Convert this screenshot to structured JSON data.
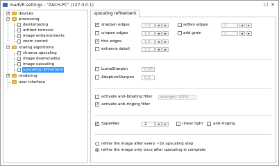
{
  "window": {
    "title": "madVR settings - \"ZACH-PC\" (127.0.0.1)",
    "close_glyph": "✕",
    "maximize_glyph": "☐"
  },
  "tree": {
    "items": [
      {
        "label": "devices",
        "icon": "folder-icon",
        "expander": "+"
      },
      {
        "label": "processing",
        "icon": "folder-icon",
        "expander": "−"
      },
      {
        "label": "deinterlacing",
        "icon": "page-icon"
      },
      {
        "label": "artifact removal",
        "icon": "page-icon"
      },
      {
        "label": "image enhancements",
        "icon": "page-icon"
      },
      {
        "label": "zoom control",
        "icon": "page-icon"
      },
      {
        "label": "scaling algorithms",
        "icon": "folder-icon",
        "expander": "−"
      },
      {
        "label": "chroma upscaling",
        "icon": "page-icon"
      },
      {
        "label": "image downscaling",
        "icon": "page-icon"
      },
      {
        "label": "image upscaling",
        "icon": "page-icon"
      },
      {
        "label": "upscaling refinement",
        "icon": "page-icon",
        "selected": true
      },
      {
        "label": "rendering",
        "icon": "folder-icon",
        "expander": "+"
      },
      {
        "label": "user interface",
        "icon": "folder-icon"
      }
    ]
  },
  "tab": {
    "label": "upscaling refinement"
  },
  "panel": {
    "sharpen_edges": {
      "label": "sharpen edges",
      "checked": true,
      "value": "1.0"
    },
    "crispen_edges": {
      "label": "crispen edges",
      "checked": false,
      "value": "1.0"
    },
    "thin_edges": {
      "label": "thin edges",
      "checked": true,
      "value": "1.0"
    },
    "enhance_detail": {
      "label": "enhance detail",
      "checked": false,
      "value": "1.0"
    },
    "soften_edges": {
      "label": "soften edges",
      "checked": false,
      "value": "2"
    },
    "add_grain": {
      "label": "add grain",
      "checked": false,
      "value": "2"
    },
    "luma_sharpen": {
      "label": "LumaSharpen",
      "checked": false,
      "value": "0.65"
    },
    "adaptive_sharpen": {
      "label": "AdaptiveSharpen",
      "checked": false,
      "value": "0.5"
    },
    "anti_bloating": {
      "label": "activate anti-bloating filter",
      "checked": false,
      "strength": "strength: 100%"
    },
    "anti_ringing": {
      "label": "activate anti-ringing filter",
      "checked": true
    },
    "superres": {
      "label": "SuperRes",
      "checked": true,
      "value": "2"
    },
    "linear_light": {
      "label": "linear light",
      "checked": false
    },
    "superres_anti_ringing": {
      "label": "anti-ringing",
      "checked": false
    },
    "refine_after_every": {
      "label": "refine the image after every ~2x upscaling step",
      "selected": false
    },
    "refine_once": {
      "label": "refine the image only once after upscaling is complete",
      "selected": true
    },
    "spin_left": "◂",
    "spin_right": "▸"
  }
}
